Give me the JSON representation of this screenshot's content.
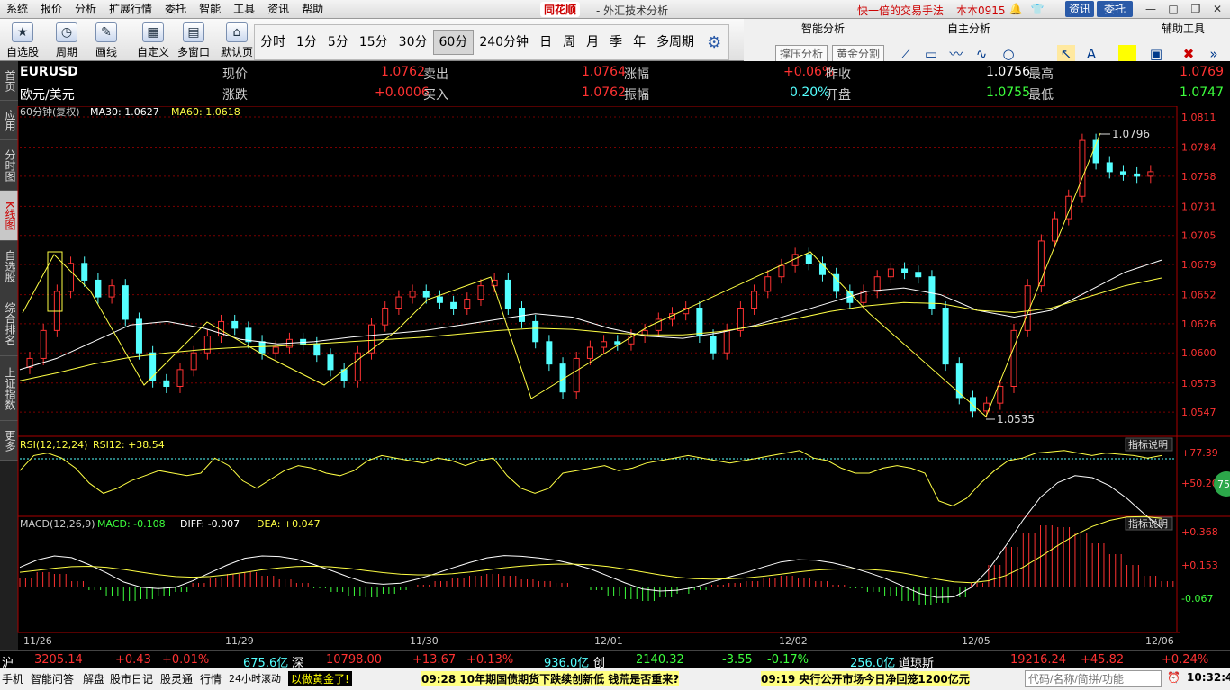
{
  "menu": [
    "系统",
    "报价",
    "分析",
    "扩展行情",
    "委托",
    "智能",
    "工具",
    "资讯",
    "帮助"
  ],
  "brand": "同花顺",
  "app_title": "- 外汇技术分析",
  "promo": "快一倍的交易手法",
  "build": "本本0915",
  "news_btn": "资讯",
  "trade_btn": "委托",
  "toolbar": {
    "zixuan": "自选股",
    "zhouqi": "周期",
    "huaxian": "画线",
    "zidingyi": "自定义",
    "duochuangkou": "多窗口",
    "morenye": "默认页"
  },
  "periods": [
    "分时",
    "1分",
    "5分",
    "15分",
    "30分",
    "60分",
    "240分钟",
    "日",
    "周",
    "月",
    "季",
    "年",
    "多周期"
  ],
  "active_period": "60分",
  "rpanel": {
    "smart": "智能分析",
    "self": "自主分析",
    "aux": "辅助工具",
    "btn1": "撑压分析",
    "btn2": "黄金分割"
  },
  "sidetabs": [
    "首页",
    "应用",
    "分时图",
    "K线图",
    "自选股",
    "综合排名",
    "上证指数",
    "更多"
  ],
  "quote": {
    "symbol": "EURUSD",
    "name": "欧元/美元",
    "l_now": "现价",
    "v_now": "1.0762",
    "l_sell": "卖出",
    "v_sell": "1.0764",
    "l_chgpct": "涨幅",
    "v_chgpct": "+0.06%",
    "l_prev": "昨收",
    "v_prev": "1.0756",
    "l_high": "最高",
    "v_high": "1.0769",
    "l_chg": "涨跌",
    "v_chg": "+0.0006",
    "l_buy": "买入",
    "v_buy": "1.0762",
    "l_amp": "振幅",
    "v_amp": "0.20%",
    "l_open": "开盘",
    "v_open": "1.0755",
    "l_low": "最低",
    "v_low": "1.0747"
  },
  "main_panel": {
    "period_label": "60分钟(复权)",
    "ma30": "MA30: 1.0627",
    "ma60": "MA60: 1.0618"
  },
  "yaxis_main": [
    "1.0811",
    "1.0784",
    "1.0758",
    "1.0731",
    "1.0705",
    "1.0679",
    "1.0652",
    "1.0626",
    "1.0600",
    "1.0573",
    "1.0547"
  ],
  "annot_high": "1.0796",
  "annot_low": "1.0535",
  "rsi_panel": {
    "label": "RSI(12,12,24)",
    "value": "RSI12: +38.54",
    "help": "指标说明",
    "ticks": [
      "+77.39",
      "+50.20"
    ]
  },
  "macd_panel": {
    "label": "MACD(12,26,9)",
    "macd": "MACD: -0.108",
    "diff": "DIFF: -0.007",
    "dea": "DEA: +0.047",
    "help": "指标说明",
    "ticks": [
      "+0.368",
      "+0.153",
      "-0.067"
    ]
  },
  "dates": [
    "11/26",
    "11/29",
    "11/30",
    "12/01",
    "12/02",
    "12/05",
    "12/06"
  ],
  "badge": "75",
  "bottombar": {
    "sh": "沪",
    "sh_v": "3205.14",
    "sh_c": "+0.43",
    "sh_p": "+0.01%",
    "sh_amt": "675.6亿",
    "sz": "深",
    "sz_v": "10798.00",
    "sz_c": "+13.67",
    "sz_p": "+0.13%",
    "sz_amt": "936.0亿",
    "cy": "创",
    "cy_v": "2140.32",
    "cy_c": "-3.55",
    "cy_p": "-0.17%",
    "cy_amt": "256.0亿",
    "dj": "道琼斯",
    "dj_v": "19216.24",
    "dj_c": "+45.82",
    "dj_p": "+0.24%"
  },
  "taskbar": {
    "items": [
      "手机",
      "智能问答",
      "解盘",
      "股市日记",
      "股灵通",
      "行情",
      "24小时滚动"
    ],
    "ad": "以做黄金了!",
    "news1": "09:28 10年期国债期货下跌续创新低 钱荒是否重来?",
    "news2": "09:19 央行公开市场今日净回笼1200亿元",
    "search_placeholder": "代码/名称/简拼/功能",
    "clock": "10:32:47"
  },
  "colors": {
    "up": "#ff3232",
    "down": "#54ffff",
    "ma30": "#ffffff",
    "ma60": "#ffff44",
    "grid": "#7a0000"
  },
  "chart_data": {
    "type": "candlestick",
    "ylim": [
      1.0535,
      1.0811
    ],
    "ma30": [
      1.0585,
      1.0595,
      1.061,
      1.0625,
      1.0628,
      1.0622,
      1.0612,
      1.0608,
      1.061,
      1.0614,
      1.0617,
      1.062,
      1.0625,
      1.063,
      1.0635,
      1.0632,
      1.0622,
      1.0615,
      1.0613,
      1.0618,
      1.0625,
      1.0635,
      1.0645,
      1.0655,
      1.0658,
      1.0652,
      1.0638,
      1.0632,
      1.0638,
      1.0655,
      1.0672,
      1.0683
    ],
    "ma60": [
      1.0575,
      1.0582,
      1.059,
      1.0596,
      1.06,
      1.0603,
      1.0605,
      1.0606,
      1.0608,
      1.061,
      1.0612,
      1.0614,
      1.0617,
      1.062,
      1.0622,
      1.0621,
      1.0618,
      1.0616,
      1.0616,
      1.0619,
      1.0624,
      1.063,
      1.0637,
      1.0642,
      1.0645,
      1.0644,
      1.0638,
      1.0636,
      1.064,
      1.065,
      1.066,
      1.0667
    ],
    "closes": [
      1.0595,
      1.062,
      1.0655,
      1.068,
      1.0665,
      1.065,
      1.066,
      1.063,
      1.06,
      1.0575,
      1.057,
      1.0585,
      1.06,
      1.0615,
      1.0628,
      1.0622,
      1.061,
      1.06,
      1.0605,
      1.0612,
      1.0608,
      1.0598,
      1.0585,
      1.0575,
      1.06,
      1.0625,
      1.064,
      1.065,
      1.0655,
      1.065,
      1.0645,
      1.064,
      1.0648,
      1.066,
      1.0665,
      1.064,
      1.0628,
      1.061,
      1.059,
      1.0565,
      1.0595,
      1.0605,
      1.061,
      1.0608,
      1.0615,
      1.062,
      1.063,
      1.0635,
      1.064,
      1.0615,
      1.06,
      1.062,
      1.064,
      1.0655,
      1.0668,
      1.0678,
      1.0688,
      1.068,
      1.067,
      1.0655,
      1.0645,
      1.0655,
      1.0668,
      1.0675,
      1.0672,
      1.0668,
      1.064,
      1.059,
      1.056,
      1.0548,
      1.0555,
      1.057,
      1.062,
      1.066,
      1.07,
      1.072,
      1.074,
      1.079,
      1.077,
      1.0762,
      1.076,
      1.0758,
      1.0762
    ],
    "rsi": [
      62,
      74,
      76,
      72,
      64,
      52,
      44,
      48,
      54,
      58,
      62,
      60,
      58,
      60,
      72,
      66,
      54,
      48,
      55,
      62,
      66,
      64,
      60,
      58,
      62,
      70,
      74,
      72,
      70,
      68,
      72,
      70,
      66,
      70,
      72,
      58,
      48,
      44,
      48,
      60,
      62,
      64,
      66,
      62,
      64,
      68,
      70,
      72,
      74,
      72,
      70,
      68,
      70,
      72,
      74,
      76,
      78,
      72,
      70,
      64,
      60,
      60,
      64,
      66,
      64,
      60,
      38,
      34,
      40,
      52,
      62,
      70,
      72,
      76,
      77,
      78,
      76,
      74,
      76,
      75,
      74,
      72,
      74
    ],
    "macd_hist": [
      0.05,
      0.08,
      0.07,
      0.03,
      -0.02,
      -0.05,
      -0.08,
      -0.07,
      -0.05,
      -0.03,
      0.02,
      0.05,
      0.07,
      0.08,
      0.06,
      0.04,
      0.02,
      -0.01,
      -0.03,
      -0.05,
      -0.06,
      -0.04,
      -0.02,
      0.01,
      0.03,
      0.05,
      0.06,
      0.07,
      0.06,
      0.04,
      0.03,
      0.02,
      0.0,
      -0.02,
      -0.05,
      -0.07,
      -0.08,
      -0.06,
      -0.04,
      -0.02,
      0.01,
      0.02,
      0.03,
      0.05,
      0.06,
      0.05,
      0.03,
      0.01,
      -0.01,
      -0.03,
      -0.05,
      -0.08,
      -0.1,
      -0.09,
      -0.06,
      0.02,
      0.12,
      0.22,
      0.3,
      0.34,
      0.33,
      0.3,
      0.24,
      0.18,
      0.12,
      0.06,
      0.03
    ]
  }
}
